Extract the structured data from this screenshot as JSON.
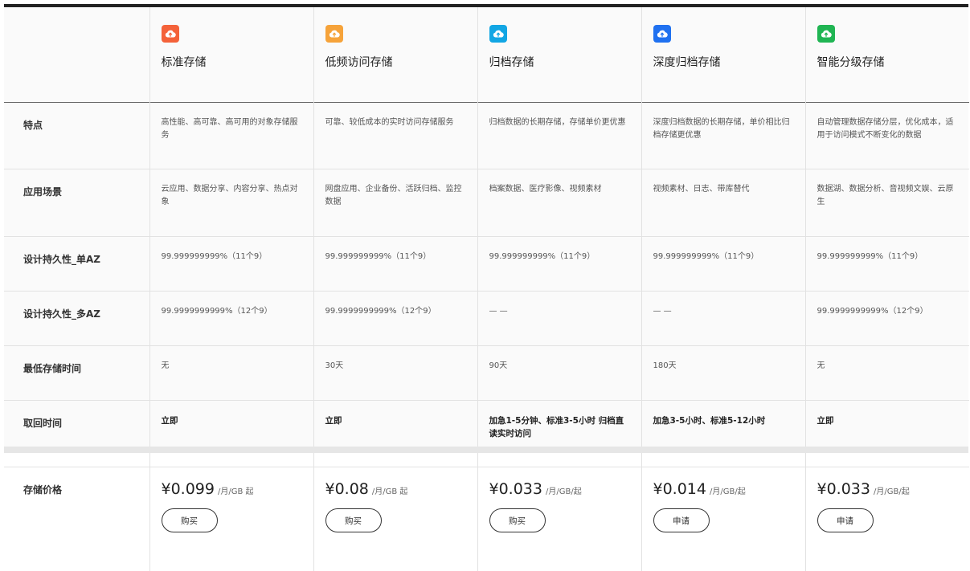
{
  "products": [
    {
      "name": "标准存储",
      "icon": "cloud-upload-icon",
      "color": "#f4623a",
      "feature": "高性能、高可靠、高可用的对象存储服务",
      "scenario": "云应用、数据分享、内容分享、热点对象",
      "durability_single": "99.999999999%（11个9）",
      "durability_multi": "99.9999999999%（12个9）",
      "min_time": "无",
      "retrieval": "立即",
      "price": "¥0.099",
      "price_unit": "/月/GB 起",
      "button": "购买"
    },
    {
      "name": "低频访问存储",
      "icon": "cloud-upload-icon",
      "color": "#f6a33a",
      "feature": "可靠、较低成本的实时访问存储服务",
      "scenario": "网盘应用、企业备份、活跃归档、监控数据",
      "durability_single": "99.999999999%（11个9）",
      "durability_multi": "99.9999999999%（12个9）",
      "min_time": "30天",
      "retrieval": "立即",
      "price": "¥0.08",
      "price_unit": "/月/GB 起",
      "button": "购买"
    },
    {
      "name": "归档存储",
      "icon": "cloud-upload-icon",
      "color": "#12a6e4",
      "feature": "归档数据的长期存储，存储单价更优惠",
      "scenario": "档案数据、医疗影像、视频素材",
      "durability_single": "99.999999999%（11个9）",
      "durability_multi": "— —",
      "min_time": "90天",
      "retrieval": "加急1-5分钟、标准3-5小时 归档直读实时访问",
      "price": "¥0.033",
      "price_unit": "/月/GB/起",
      "button": "购买"
    },
    {
      "name": "深度归档存储",
      "icon": "cloud-upload-icon",
      "color": "#2071f0",
      "feature": "深度归档数据的长期存储，单价相比归档存储更优惠",
      "scenario": "视频素材、日志、带库替代",
      "durability_single": "99.999999999%（11个9）",
      "durability_multi": "— —",
      "min_time": "180天",
      "retrieval": "加急3-5小时、标准5-12小时",
      "price": "¥0.014",
      "price_unit": "/月/GB/起",
      "button": "申请"
    },
    {
      "name": "智能分级存储",
      "icon": "cloud-upload-icon",
      "color": "#20b553",
      "feature": "自动管理数据存储分层，优化成本，适用于访问模式不断变化的数据",
      "scenario": "数据湖、数据分析、音视频文娱、云原生",
      "durability_single": "99.999999999%（11个9）",
      "durability_multi": "99.9999999999%（12个9）",
      "min_time": "无",
      "retrieval": "立即",
      "price": "¥0.033",
      "price_unit": "/月/GB/起",
      "button": "申请"
    }
  ],
  "row_labels": {
    "feature": "特点",
    "scenario": "应用场景",
    "durability_single": "设计持久性_单AZ",
    "durability_multi": "设计持久性_多AZ",
    "min_time": "最低存储时间",
    "retrieval": "取回时间",
    "price": "存储价格"
  }
}
